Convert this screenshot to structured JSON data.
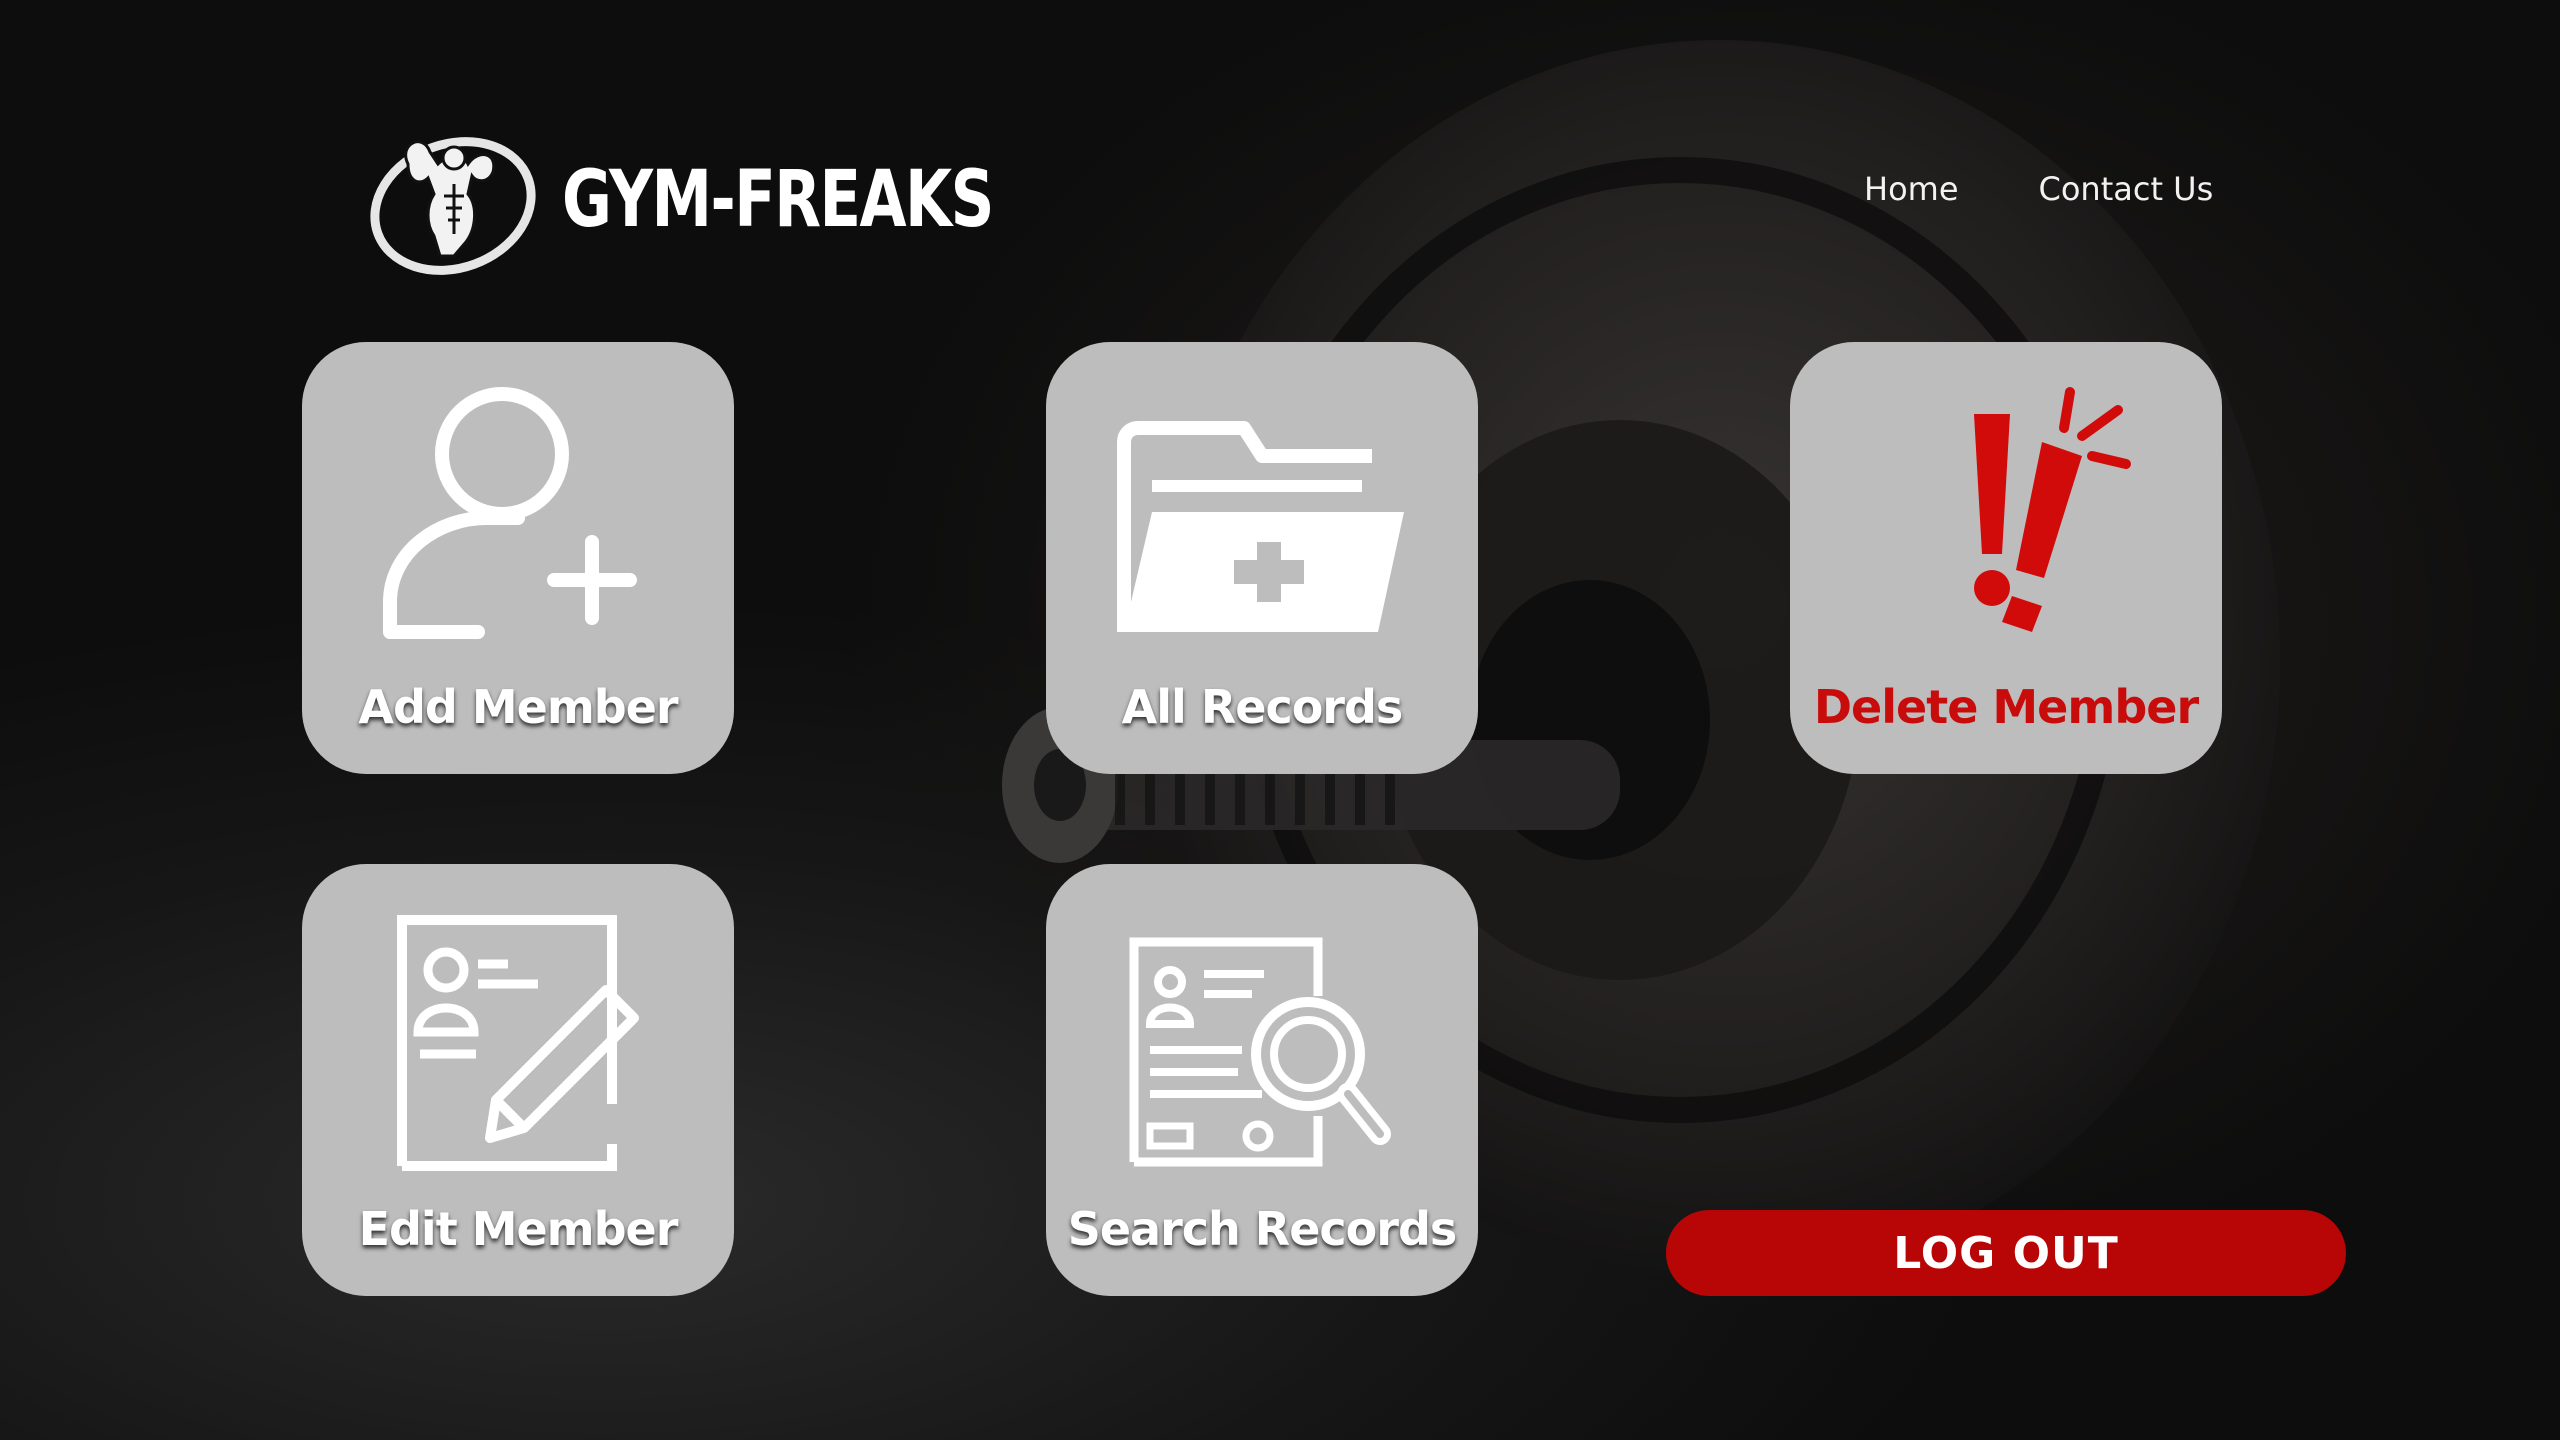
{
  "brand": {
    "name": "GYM-FREAKS",
    "logo_icon": "bodybuilder-logo-icon"
  },
  "nav": {
    "home": "Home",
    "contact": "Contact Us"
  },
  "tiles": [
    {
      "label": "Add Member",
      "icon": "add-user-icon"
    },
    {
      "label": "All Records",
      "icon": "folder-plus-icon"
    },
    {
      "label": "Delete Member",
      "icon": "exclamation-icon"
    },
    {
      "label": "Edit Member",
      "icon": "edit-document-icon"
    },
    {
      "label": "Search Records",
      "icon": "document-search-icon"
    }
  ],
  "logout": {
    "label": "LOG OUT"
  },
  "colors": {
    "tile_bg": "#bdbdbd",
    "accent_red": "#b80606",
    "danger_text": "#c80c0c",
    "text": "#ffffff"
  }
}
